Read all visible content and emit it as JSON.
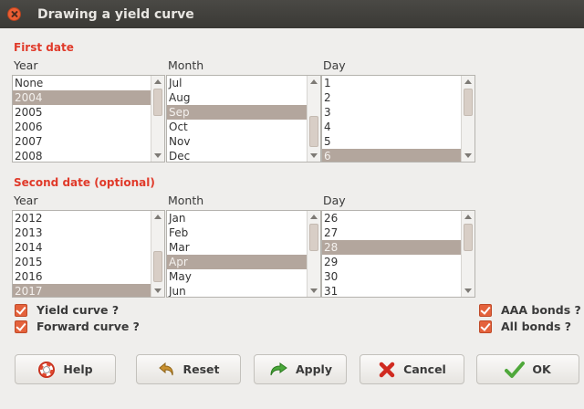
{
  "window": {
    "title": "Drawing a yield curve"
  },
  "first_date": {
    "section_label": "First date",
    "year": {
      "label": "Year",
      "items": [
        "None",
        "2004",
        "2005",
        "2006",
        "2007",
        "2008"
      ],
      "selected": "2004"
    },
    "month": {
      "label": "Month",
      "items": [
        "Jul",
        "Aug",
        "Sep",
        "Oct",
        "Nov",
        "Dec"
      ],
      "selected": "Sep"
    },
    "day": {
      "label": "Day",
      "items": [
        "1",
        "2",
        "3",
        "4",
        "5",
        "6"
      ],
      "selected": "6"
    }
  },
  "second_date": {
    "section_label": "Second date (optional)",
    "year": {
      "label": "Year",
      "items": [
        "2012",
        "2013",
        "2014",
        "2015",
        "2016",
        "2017"
      ],
      "selected": "2017"
    },
    "month": {
      "label": "Month",
      "items": [
        "Jan",
        "Feb",
        "Mar",
        "Apr",
        "May",
        "Jun"
      ],
      "selected": "Apr"
    },
    "day": {
      "label": "Day",
      "items": [
        "26",
        "27",
        "28",
        "29",
        "30",
        "31"
      ],
      "selected": "28"
    }
  },
  "options": {
    "yield_curve": {
      "label": "Yield curve ?",
      "checked": true
    },
    "forward_curve": {
      "label": "Forward curve ?",
      "checked": true
    },
    "aaa_bonds": {
      "label": "AAA bonds ?",
      "checked": true
    },
    "all_bonds": {
      "label": "All bonds ?",
      "checked": true
    }
  },
  "buttons": {
    "help": "Help",
    "reset": "Reset",
    "apply": "Apply",
    "cancel": "Cancel",
    "ok": "OK"
  },
  "colors": {
    "accent": "#e03a2a",
    "selection": "#b3a69d",
    "checkbox": "#e4623c"
  }
}
